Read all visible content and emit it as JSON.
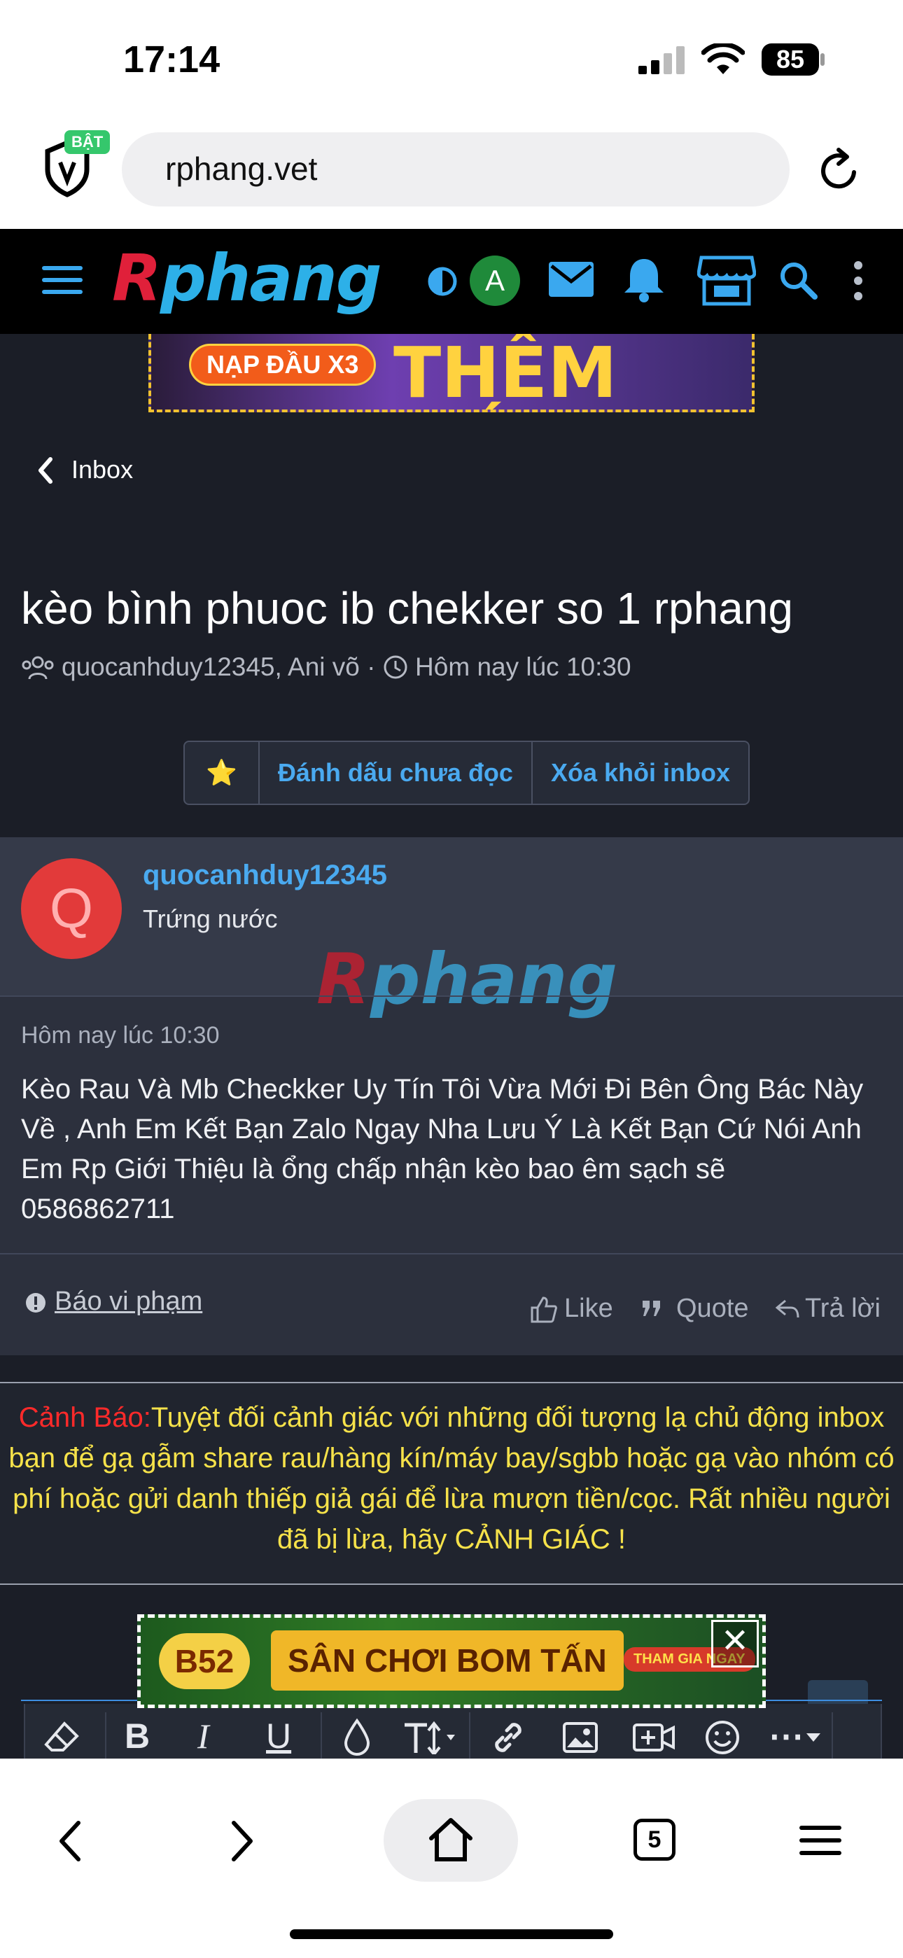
{
  "status_bar": {
    "time": "17:14",
    "battery": "85"
  },
  "browser": {
    "url": "rphang.vet",
    "shield_badge": "BẬT",
    "tab_count": "5"
  },
  "site_header": {
    "logo_part1": "R",
    "logo_part2": "phang",
    "avatar_letter": "A"
  },
  "top_banner": {
    "tag": "NẠP ĐẦU X3",
    "headline": "THÊM VỐN"
  },
  "breadcrumb": {
    "back_label": "Inbox"
  },
  "conversation": {
    "title": "kèo bình phuoc ib chekker so 1 rphang",
    "participants": "quocanhduy12345, Ani võ",
    "separator": "·",
    "time": "Hôm nay lúc 10:30",
    "actions": {
      "star": "⭐",
      "mark_unread": "Đánh dấu chưa đọc",
      "remove": "Xóa khỏi inbox"
    }
  },
  "post": {
    "avatar_letter": "Q",
    "username": "quocanhduy12345",
    "user_title": "Trứng nước",
    "watermark_part1": "R",
    "watermark_part2": "phang",
    "time": "Hôm nay lúc 10:30",
    "body": "Kèo Rau Và Mb Checkker Uy Tín Tôi Vừa Mới Đi Bên Ông Bác Này Về , Anh Em Kết Bạn Zalo Ngay Nha Lưu Ý Là Kết Bạn Cứ Nói Anh Em Rp Giới Thiệu là ổng chấp nhận kèo bao êm sạch sẽ 0586862711",
    "report_label": "Báo vi phạm",
    "like_label": "Like",
    "quote_label": "Quote",
    "reply_label": "Trả lời"
  },
  "warning": {
    "prefix": "Cảnh Báo:",
    "text": "Tuyệt đối cảnh giác với những đối tượng lạ chủ động inbox bạn để gạ gẫm share rau/hàng kín/máy bay/sgbb hoặc gạ vào nhóm có phí hoặc gửi danh thiếp giả gái để lừa mượn tiền/cọc. Rất nhiều người đã bị lừa, hãy CẢNH GIÁC !"
  },
  "bottom_banner": {
    "brand": "B52",
    "headline": "SÂN CHƠI BOM TẤN",
    "cta": "THAM GIA NGAY",
    "close": "✕"
  },
  "editor_toolbar": {
    "bold": "B",
    "italic": "I",
    "underline": "U",
    "more": "⋯"
  },
  "colors": {
    "accent": "#4aaaf0",
    "warning_text": "#f6e24a",
    "warning_prefix": "#ff2a2a",
    "avatar_q": "#e23a3a",
    "avatar_a": "#1f8a3a"
  }
}
